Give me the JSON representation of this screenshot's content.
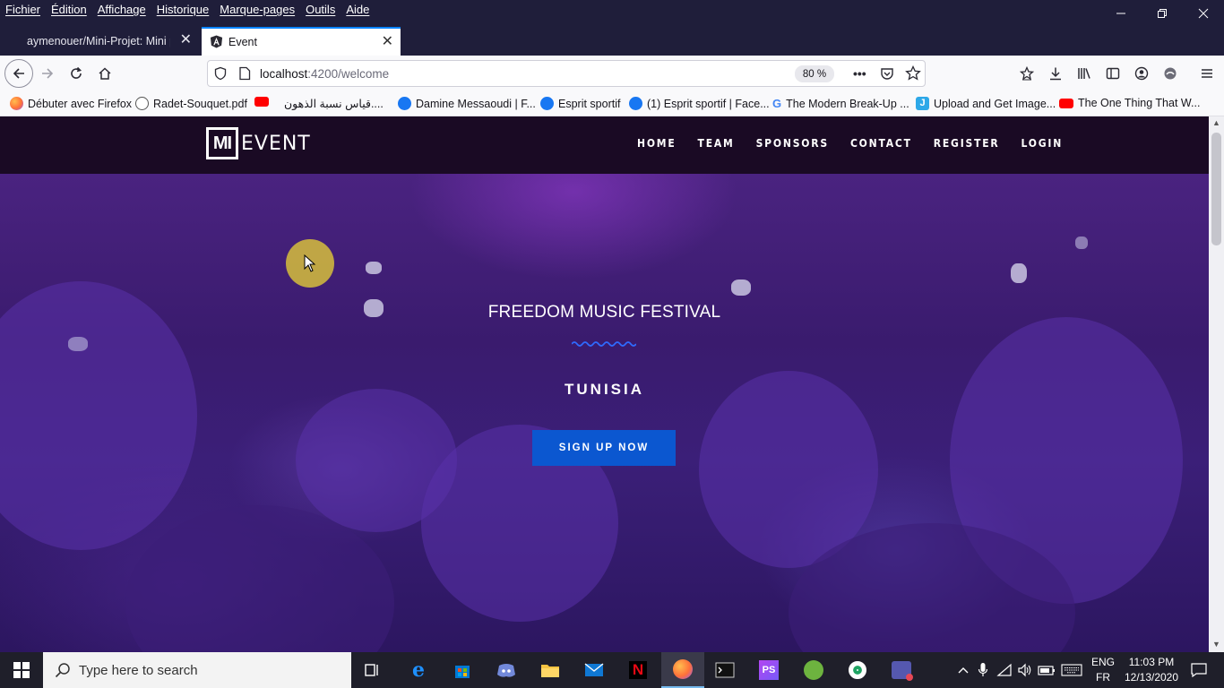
{
  "menubar": {
    "items": [
      "Fichier",
      "Édition",
      "Affichage",
      "Historique",
      "Marque-pages",
      "Outils",
      "Aide"
    ]
  },
  "tabs": [
    {
      "title": "aymenouer/Mini-Projet: Mini p",
      "active": false
    },
    {
      "title": "Event",
      "active": true
    }
  ],
  "address": {
    "host": "localhost",
    "path": ":4200/welcome",
    "zoom": "80 %"
  },
  "bookmarks": [
    {
      "label": "Débuter avec Firefox",
      "icon": "firefox-icon",
      "color": "#ff7139"
    },
    {
      "label": "Radet-Souquet.pdf",
      "icon": "globe-icon",
      "color": "#555555"
    },
    {
      "label": "",
      "icon": "youtube-icon",
      "color": "#ff0000"
    },
    {
      "label": "قياس نسبة الذهون....",
      "icon": "",
      "color": ""
    },
    {
      "label": "Damine Messaoudi | F...",
      "icon": "facebook-icon",
      "color": "#1877f2"
    },
    {
      "label": "Esprit sportif",
      "icon": "facebook-icon",
      "color": "#1877f2"
    },
    {
      "label": "(1) Esprit sportif | Face...",
      "icon": "facebook-icon",
      "color": "#1877f2"
    },
    {
      "label": "The Modern Break-Up ...",
      "icon": "google-icon",
      "color": "#4285f4"
    },
    {
      "label": "Upload and Get Image...",
      "icon": "jotform-icon",
      "color": "#2da8e8"
    },
    {
      "label": "The One Thing That W...",
      "icon": "youtube-icon",
      "color": "#ff0000"
    }
  ],
  "site": {
    "logo_mark": "MI",
    "logo_word": "EVENT",
    "nav": [
      "HOME",
      "TEAM",
      "SPONSORS",
      "CONTACT",
      "REGISTER",
      "LOGIN"
    ],
    "hero_title": "FREEDOM MUSIC FESTIVAL",
    "hero_subtitle": "TUNISIA",
    "cta": "SIGN UP NOW",
    "accent": "#0b57d0"
  },
  "taskbar": {
    "search_placeholder": "Type here to search",
    "lang_top": "ENG",
    "lang_bottom": "FR",
    "time": "11:03 PM",
    "date": "12/13/2020"
  }
}
